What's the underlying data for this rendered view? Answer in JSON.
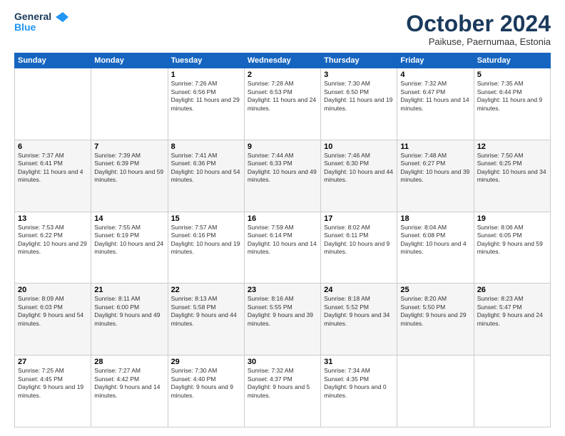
{
  "logo": {
    "line1": "General",
    "line2": "Blue"
  },
  "header": {
    "month": "October 2024",
    "location": "Paikuse, Paernumaa, Estonia"
  },
  "weekdays": [
    "Sunday",
    "Monday",
    "Tuesday",
    "Wednesday",
    "Thursday",
    "Friday",
    "Saturday"
  ],
  "weeks": [
    [
      {
        "day": "",
        "info": ""
      },
      {
        "day": "",
        "info": ""
      },
      {
        "day": "1",
        "info": "Sunrise: 7:26 AM\nSunset: 6:56 PM\nDaylight: 11 hours and 29 minutes."
      },
      {
        "day": "2",
        "info": "Sunrise: 7:28 AM\nSunset: 6:53 PM\nDaylight: 11 hours and 24 minutes."
      },
      {
        "day": "3",
        "info": "Sunrise: 7:30 AM\nSunset: 6:50 PM\nDaylight: 11 hours and 19 minutes."
      },
      {
        "day": "4",
        "info": "Sunrise: 7:32 AM\nSunset: 6:47 PM\nDaylight: 11 hours and 14 minutes."
      },
      {
        "day": "5",
        "info": "Sunrise: 7:35 AM\nSunset: 6:44 PM\nDaylight: 11 hours and 9 minutes."
      }
    ],
    [
      {
        "day": "6",
        "info": "Sunrise: 7:37 AM\nSunset: 6:41 PM\nDaylight: 11 hours and 4 minutes."
      },
      {
        "day": "7",
        "info": "Sunrise: 7:39 AM\nSunset: 6:39 PM\nDaylight: 10 hours and 59 minutes."
      },
      {
        "day": "8",
        "info": "Sunrise: 7:41 AM\nSunset: 6:36 PM\nDaylight: 10 hours and 54 minutes."
      },
      {
        "day": "9",
        "info": "Sunrise: 7:44 AM\nSunset: 6:33 PM\nDaylight: 10 hours and 49 minutes."
      },
      {
        "day": "10",
        "info": "Sunrise: 7:46 AM\nSunset: 6:30 PM\nDaylight: 10 hours and 44 minutes."
      },
      {
        "day": "11",
        "info": "Sunrise: 7:48 AM\nSunset: 6:27 PM\nDaylight: 10 hours and 39 minutes."
      },
      {
        "day": "12",
        "info": "Sunrise: 7:50 AM\nSunset: 6:25 PM\nDaylight: 10 hours and 34 minutes."
      }
    ],
    [
      {
        "day": "13",
        "info": "Sunrise: 7:53 AM\nSunset: 6:22 PM\nDaylight: 10 hours and 29 minutes."
      },
      {
        "day": "14",
        "info": "Sunrise: 7:55 AM\nSunset: 6:19 PM\nDaylight: 10 hours and 24 minutes."
      },
      {
        "day": "15",
        "info": "Sunrise: 7:57 AM\nSunset: 6:16 PM\nDaylight: 10 hours and 19 minutes."
      },
      {
        "day": "16",
        "info": "Sunrise: 7:59 AM\nSunset: 6:14 PM\nDaylight: 10 hours and 14 minutes."
      },
      {
        "day": "17",
        "info": "Sunrise: 8:02 AM\nSunset: 6:11 PM\nDaylight: 10 hours and 9 minutes."
      },
      {
        "day": "18",
        "info": "Sunrise: 8:04 AM\nSunset: 6:08 PM\nDaylight: 10 hours and 4 minutes."
      },
      {
        "day": "19",
        "info": "Sunrise: 8:06 AM\nSunset: 6:05 PM\nDaylight: 9 hours and 59 minutes."
      }
    ],
    [
      {
        "day": "20",
        "info": "Sunrise: 8:09 AM\nSunset: 6:03 PM\nDaylight: 9 hours and 54 minutes."
      },
      {
        "day": "21",
        "info": "Sunrise: 8:11 AM\nSunset: 6:00 PM\nDaylight: 9 hours and 49 minutes."
      },
      {
        "day": "22",
        "info": "Sunrise: 8:13 AM\nSunset: 5:58 PM\nDaylight: 9 hours and 44 minutes."
      },
      {
        "day": "23",
        "info": "Sunrise: 8:16 AM\nSunset: 5:55 PM\nDaylight: 9 hours and 39 minutes."
      },
      {
        "day": "24",
        "info": "Sunrise: 8:18 AM\nSunset: 5:52 PM\nDaylight: 9 hours and 34 minutes."
      },
      {
        "day": "25",
        "info": "Sunrise: 8:20 AM\nSunset: 5:50 PM\nDaylight: 9 hours and 29 minutes."
      },
      {
        "day": "26",
        "info": "Sunrise: 8:23 AM\nSunset: 5:47 PM\nDaylight: 9 hours and 24 minutes."
      }
    ],
    [
      {
        "day": "27",
        "info": "Sunrise: 7:25 AM\nSunset: 4:45 PM\nDaylight: 9 hours and 19 minutes."
      },
      {
        "day": "28",
        "info": "Sunrise: 7:27 AM\nSunset: 4:42 PM\nDaylight: 9 hours and 14 minutes."
      },
      {
        "day": "29",
        "info": "Sunrise: 7:30 AM\nSunset: 4:40 PM\nDaylight: 9 hours and 9 minutes."
      },
      {
        "day": "30",
        "info": "Sunrise: 7:32 AM\nSunset: 4:37 PM\nDaylight: 9 hours and 5 minutes."
      },
      {
        "day": "31",
        "info": "Sunrise: 7:34 AM\nSunset: 4:35 PM\nDaylight: 9 hours and 0 minutes."
      },
      {
        "day": "",
        "info": ""
      },
      {
        "day": "",
        "info": ""
      }
    ]
  ]
}
